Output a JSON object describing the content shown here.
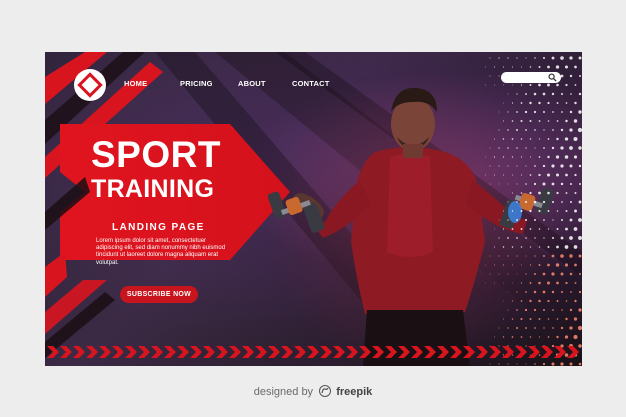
{
  "nav": {
    "items": [
      {
        "label": "HOME"
      },
      {
        "label": "PRICING"
      },
      {
        "label": "ABOUT"
      },
      {
        "label": "CONTACT"
      }
    ]
  },
  "search": {
    "placeholder": "",
    "icon": "search-icon"
  },
  "hero": {
    "title_line1": "SPORT",
    "title_line2": "TRAINING",
    "subtitle": "LANDING PAGE",
    "body": "Lorem ipsum dolor sit amet, consectetuer adipiscing elit, sed diam nonummy nibh euismod tincidunt ut laoreet dolore magna aliquam erat volutpat.",
    "cta_label": "SUBSCRIBE NOW"
  },
  "footer": {
    "prefix": "designed by",
    "brand": "freepik"
  },
  "colors": {
    "accent_red": "#d8141f",
    "dark_red": "#8e0d14",
    "background_dark": "#2a1f33",
    "text_white": "#ffffff"
  }
}
